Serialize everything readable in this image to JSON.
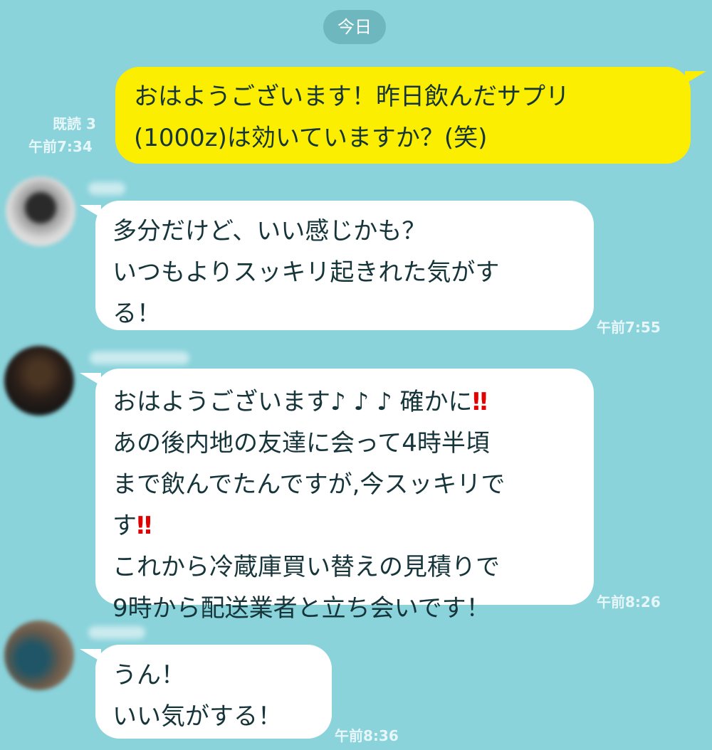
{
  "date_separator": "今日",
  "messages": [
    {
      "side": "self",
      "lines": [
        "おはようございます！昨日飲んだサプリ",
        "(1000z)は効いていますか？(笑)"
      ],
      "read_receipt": "既読 3",
      "time": "午前7:34"
    },
    {
      "side": "other",
      "lines": [
        "多分だけど、いい感じかも？",
        "いつもよりスッキリ起きれた気がす",
        "る！"
      ],
      "time": "午前7:55"
    },
    {
      "side": "other",
      "lines": [
        "おはようございます♪ ♪ ♪ 確かに",
        "あの後内地の友達に会って4時半頃",
        "まで飲んでたんですが,今スッキリで",
        "す",
        "これから冷蔵庫買い替えの見積りで",
        "9時から配送業者と立ち会いです！"
      ],
      "emphasis": "‼",
      "time": "午前8:26"
    },
    {
      "side": "other",
      "lines": [
        "うん！",
        "いい気がする！"
      ],
      "time": "午前8:36"
    }
  ],
  "colors": {
    "background": "#8ad3db",
    "self_bubble": "#fbee00",
    "other_bubble": "#ffffff",
    "emphasis": "#e00000"
  }
}
